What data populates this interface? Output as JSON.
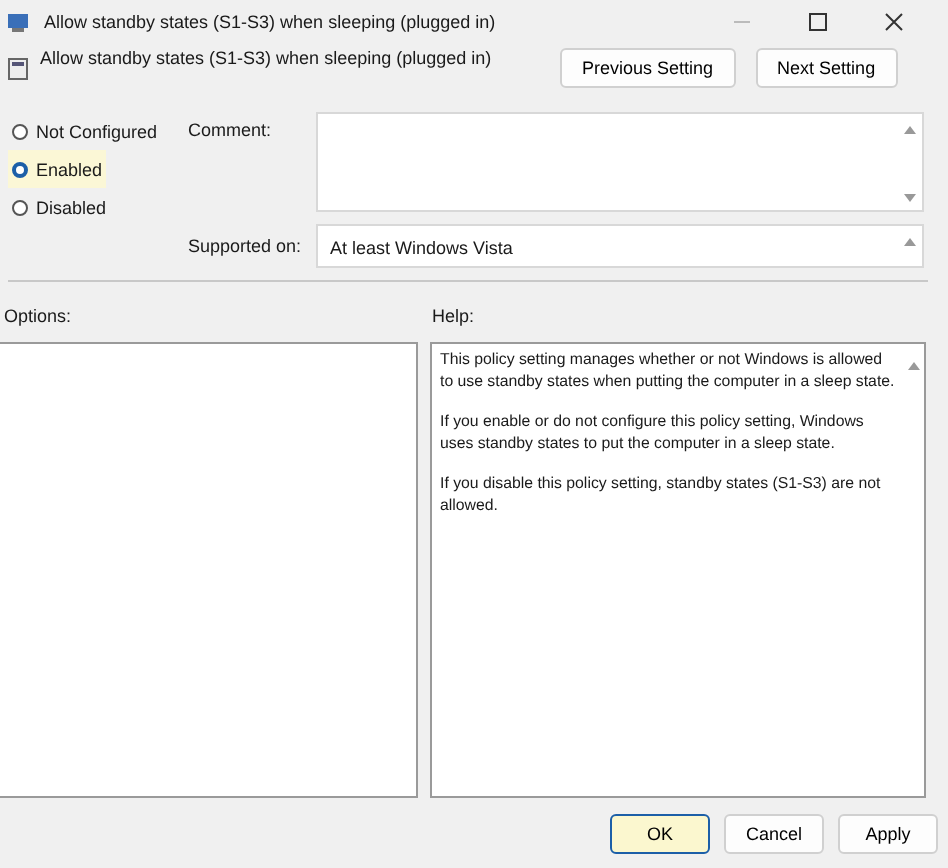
{
  "window": {
    "title": "Allow standby states (S1-S3) when sleeping (plugged in)"
  },
  "header": {
    "title": "Allow standby states (S1-S3) when sleeping (plugged in)",
    "buttons": [
      "Previous Setting",
      "Next Setting"
    ]
  },
  "options": [
    {
      "label": "Not Configured",
      "selected": false
    },
    {
      "label": "Enabled",
      "selected": true
    },
    {
      "label": "Disabled",
      "selected": false
    }
  ],
  "comment": {
    "label": "Comment:"
  },
  "supported": {
    "label": "Supported on:",
    "value": "At least Windows Vista"
  },
  "options_label": "Options:",
  "help": {
    "label": "Help:",
    "paragraphs": [
      "This policy setting manages whether or not Windows is allowed to use standby states when putting the computer in a sleep state.",
      "If you enable or do not configure this policy setting, Windows uses standby states to put the computer in a sleep state.",
      "If you disable this policy setting, standby states (S1-S3) are not allowed."
    ]
  },
  "buttons": [
    {
      "label": "OK",
      "default": true
    },
    {
      "label": "Cancel",
      "default": false
    },
    {
      "label": "Apply",
      "default": false
    }
  ]
}
